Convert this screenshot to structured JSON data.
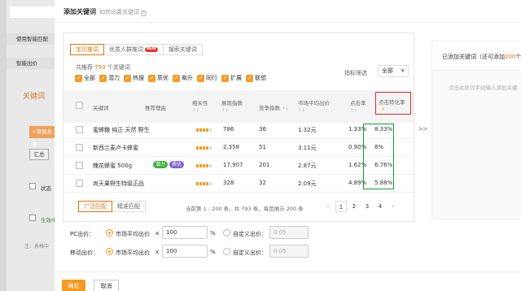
{
  "background": {
    "sidebar_items": [
      "使用智能匹配",
      "智能出价"
    ],
    "keyword_heading": "关键词",
    "add_keyword_btn": "+添加关键",
    "summary_tab": "汇总",
    "status_col": "状态",
    "effective": "生效中",
    "note": "注：表格中"
  },
  "modal": {
    "title": "添加关键词",
    "help": "如何设置关键词",
    "tabs": [
      {
        "label": "宝贝推词",
        "active": true
      },
      {
        "label": "优质人群推词",
        "badge": "NEW"
      },
      {
        "label": "搜索关键词"
      }
    ],
    "recommend_prefix": "共推荐",
    "recommend_count": "793",
    "recommend_suffix": "个关键词",
    "filters": [
      "全部",
      "潜力",
      "热搜",
      "质优",
      "飙升",
      "同行",
      "扩展",
      "联想"
    ],
    "sort_label": "指标筛选",
    "sort_value": "全部",
    "columns": [
      "关键词",
      "推荐理由",
      "相关性",
      "展现指数",
      "竞争指数",
      "市场平均出价",
      "点击率",
      "点击转化率"
    ],
    "rows": [
      {
        "keyword": "蜜蜂糖 纯正 天然 野生",
        "reason": [],
        "relevance": 4,
        "impressions": "786",
        "competition": "36",
        "avg_bid": "1.32元",
        "ctr": "1.33%",
        "cvr": "8.33%"
      },
      {
        "keyword": "新西兰麦卢卡蜂蜜",
        "reason": [],
        "relevance": 4,
        "impressions": "2,358",
        "competition": "51",
        "avg_bid": "3.11元",
        "ctr": "0.90%",
        "cvr": "8%"
      },
      {
        "keyword": "槐花蜂蜜 500g",
        "reason": [
          {
            "text": "潜力",
            "color": "#3bb33b"
          },
          {
            "text": "质优",
            "color": "#7b5fd8"
          }
        ],
        "relevance": 4,
        "impressions": "17,907",
        "competition": "201",
        "avg_bid": "2.87元",
        "ctr": "1.62%",
        "cvr": "6.76%"
      },
      {
        "keyword": "尚天果野生特级正品",
        "reason": [],
        "relevance": 4,
        "impressions": "328",
        "competition": "32",
        "avg_bid": "2.09元",
        "ctr": "4.89%",
        "cvr": "5.88%"
      }
    ],
    "match_tabs": [
      {
        "label": "广泛匹配",
        "active": true
      },
      {
        "label": "精准匹配"
      }
    ],
    "pager_text": "当前第 1 - 200 条，共 793 条，每页展示 200 条",
    "pages": [
      "1",
      "2",
      "3",
      "4"
    ],
    "page_prev": "‹",
    "page_next": "›",
    "transfer": ">>",
    "added_title_prefix": "已添加关键词（还可添加",
    "added_title_count": "200",
    "added_title_suffix": "个",
    "added_hint": "点击此处可手动输入添加关键",
    "pc_label": "PC出价：",
    "mobile_label": "移动出价：",
    "market_avg": "市场平均出价",
    "mult": "x",
    "pct": "%",
    "custom": "自定义出价：",
    "pc_value": "100",
    "mobile_value": "100",
    "custom_placeholder": "0.05",
    "ok": "确定",
    "cancel": "取消"
  },
  "colors": {
    "accent": "#f39b22",
    "highlight_red": "#e0282a",
    "highlight_green": "#0da330"
  }
}
